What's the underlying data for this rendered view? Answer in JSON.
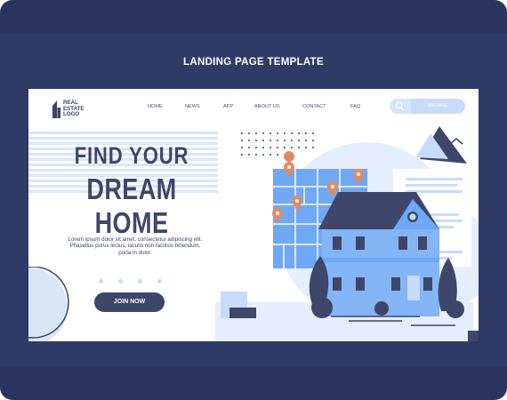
{
  "banner_title": "LANDING PAGE TEMPLATE",
  "logo": {
    "line1": "REAL",
    "line2": "ESTATE",
    "line3": "LOGO"
  },
  "nav": [
    {
      "label": "HOME"
    },
    {
      "label": "NEWS"
    },
    {
      "label": "APP"
    },
    {
      "label": "ABOUT US"
    },
    {
      "label": "CONTACT"
    },
    {
      "label": "FAQ"
    }
  ],
  "search": {
    "icon": "search-icon",
    "button_label": "BROWSE"
  },
  "hero": {
    "title_line1": "FIND YOUR",
    "title_line2": "DREAM HOME",
    "description": "Lorem ipsum dolor sit amet, consectetur adipiscing elit. Phasellus purus lectus, iaculis non facilisis bibendum, porta in dolor.",
    "cta_label": "JOIN NOW"
  },
  "colors": {
    "frame": "#2b3560",
    "navy": "#3e4769",
    "light_blue": "#c6dcfa",
    "pale_blue": "#d9e6f8",
    "mid_blue": "#6fa8f5",
    "pin": "#e58a5f"
  }
}
